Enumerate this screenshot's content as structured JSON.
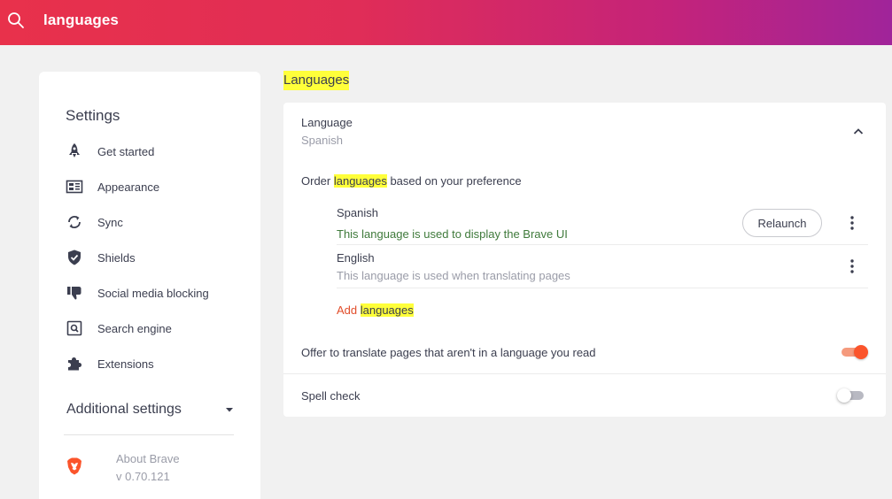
{
  "search": {
    "query": "languages"
  },
  "sidebar": {
    "title": "Settings",
    "items": [
      {
        "label": "Get started",
        "icon": "rocket-icon"
      },
      {
        "label": "Appearance",
        "icon": "appearance-icon"
      },
      {
        "label": "Sync",
        "icon": "sync-icon"
      },
      {
        "label": "Shields",
        "icon": "shield-icon"
      },
      {
        "label": "Social media blocking",
        "icon": "thumbs-down-icon"
      },
      {
        "label": "Search engine",
        "icon": "search-engine-icon"
      },
      {
        "label": "Extensions",
        "icon": "puzzle-icon"
      }
    ],
    "additional_settings": "Additional settings",
    "about": {
      "name": "About Brave",
      "version": "v 0.70.121"
    }
  },
  "section": {
    "title": "Languages"
  },
  "languages_card": {
    "language_label": "Language",
    "language_value": "Spanish",
    "order_prefix": "Order ",
    "order_highlight": "languages",
    "order_suffix": " based on your preference",
    "rows": [
      {
        "name": "Spanish",
        "desc": "This language is used to display the Brave UI",
        "desc_color": "#3f7a3b",
        "action": "Relaunch"
      },
      {
        "name": "English",
        "desc": "This language is used when translating pages",
        "desc_color": "#9a9ca8"
      }
    ],
    "add_prefix": "Add ",
    "add_highlight": "languages",
    "offer_translate": {
      "label": "Offer to translate pages that aren't in a language you read",
      "enabled": true
    },
    "spell_check": {
      "label": "Spell check",
      "enabled": false
    }
  },
  "colors": {
    "accent": "#fb542b",
    "highlight": "#ffff3a",
    "link": "#e14d2a"
  }
}
